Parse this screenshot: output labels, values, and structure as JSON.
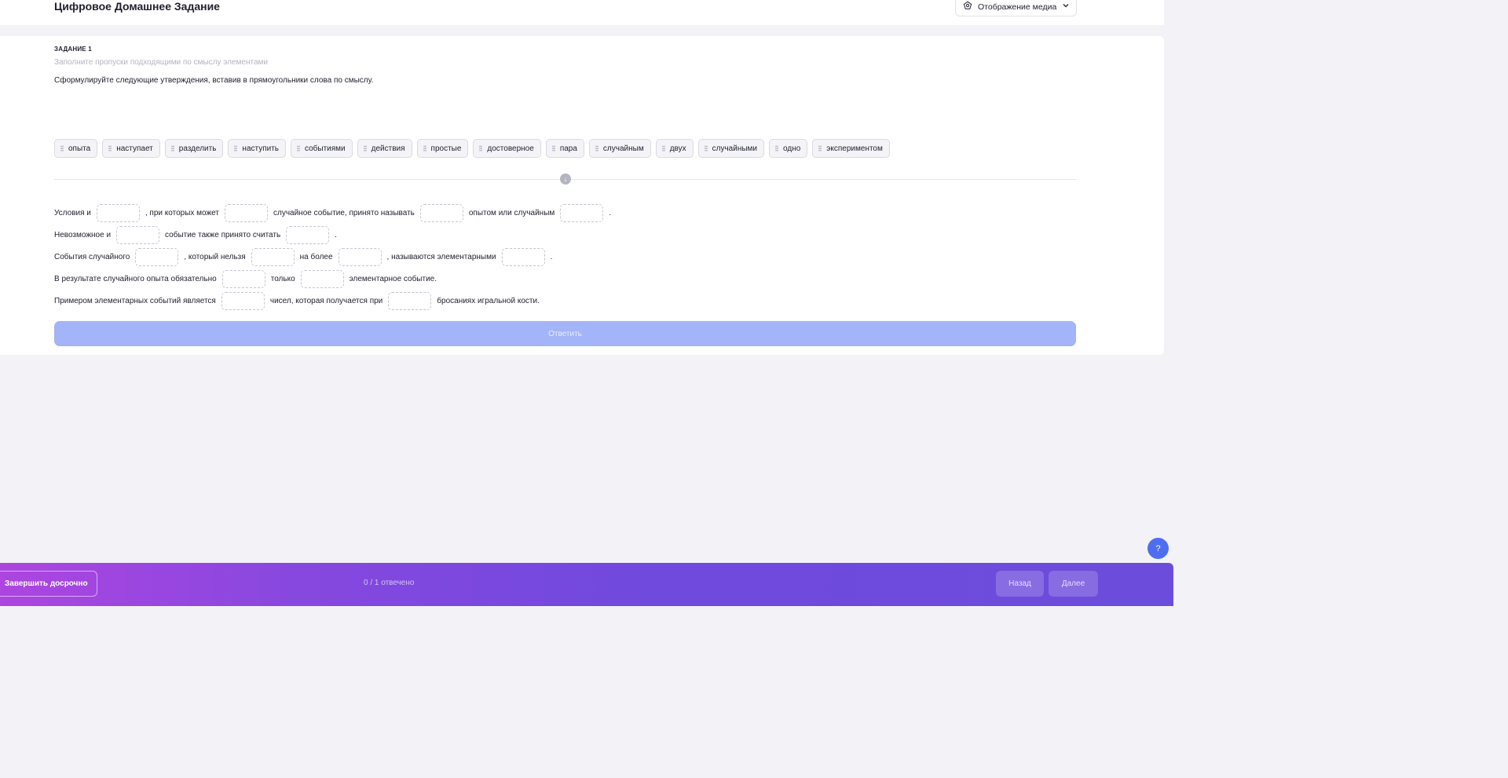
{
  "header": {
    "title": "Цифровое Домашнее Задание",
    "media_button_label": "Отображение медиа",
    "media_icon": "settings-icon",
    "chevron_icon": "chevron-down-icon"
  },
  "task": {
    "number_label": "ЗАДАНИЕ 1",
    "hint": "Заполните пропуски подходящими по смыслу элементами",
    "instruction": "Сформулируйте следующие утверждения, вставив в прямоугольники слова по смыслу."
  },
  "word_bank": [
    "опыта",
    "наступает",
    "разделить",
    "наступить",
    "событиями",
    "действия",
    "простые",
    "достоверное",
    "пара",
    "случайным",
    "двух",
    "случайными",
    "одно",
    "экспериментом"
  ],
  "sentences": [
    {
      "parts": [
        "Условия и",
        ", при которых может",
        "случайное событие, принято называть",
        "опытом или случайным",
        "."
      ]
    },
    {
      "parts": [
        "Невозможное и",
        "событие также принято считать",
        "."
      ]
    },
    {
      "parts": [
        "События случайного",
        ", который нельзя",
        "на более",
        ", называются элементарными",
        "."
      ]
    },
    {
      "parts": [
        "В результате случайного опыта обязательно",
        "только",
        "элементарное событие."
      ]
    },
    {
      "parts": [
        "Примером элементарных событий является",
        "чисел, которая получается при",
        "бросаниях игральной кости."
      ]
    }
  ],
  "submit_label": "Ответить",
  "help_label": "?",
  "footer": {
    "finish_label": "Завершить досрочно",
    "progress": "0 / 1 отвечено",
    "back_label": "Назад",
    "next_label": "Далее"
  },
  "colors": {
    "accent": "#4e6ef2",
    "submit_disabled": "#a3b4f8",
    "footer_gradient_start": "#ad45e0",
    "footer_gradient_end": "#6c4ddb"
  }
}
